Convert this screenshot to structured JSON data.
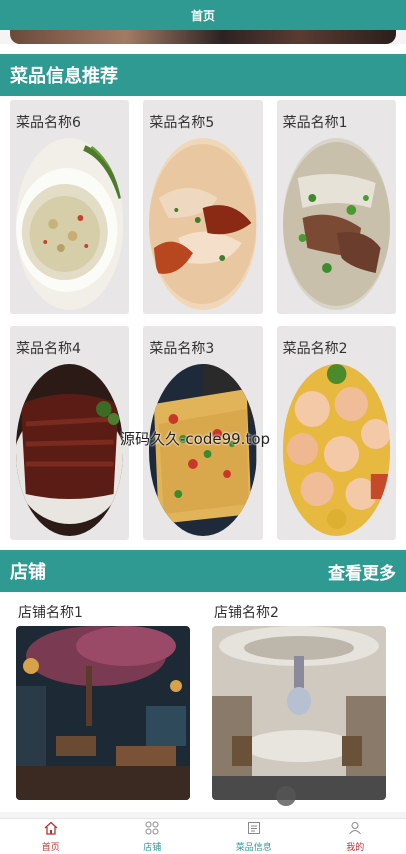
{
  "status_bar": {
    "title": "首页"
  },
  "dishes_section": {
    "title": "菜品信息推荐",
    "items": [
      {
        "name": "菜品名称6",
        "image": "creamy-soup-dish"
      },
      {
        "name": "菜品名称5",
        "image": "wonton-chili-dish"
      },
      {
        "name": "菜品名称1",
        "image": "beef-noodle-soup"
      },
      {
        "name": "菜品名称4",
        "image": "braised-beef-slices"
      },
      {
        "name": "菜品名称3",
        "image": "pizza-slice"
      },
      {
        "name": "菜品名称2",
        "image": "shrimp-dish"
      }
    ]
  },
  "shops_section": {
    "title": "店铺",
    "more_label": "查看更多",
    "items": [
      {
        "name": "店铺名称1",
        "image": "restaurant-interior-trees"
      },
      {
        "name": "店铺名称2",
        "image": "restaurant-interior-chandelier"
      }
    ]
  },
  "watermark": "源码久久-code99.top",
  "bottom_nav": [
    {
      "label": "首页",
      "icon": "home-icon"
    },
    {
      "label": "店铺",
      "icon": "grid-icon"
    },
    {
      "label": "菜品信息",
      "icon": "document-icon"
    },
    {
      "label": "我的",
      "icon": "user-icon"
    }
  ],
  "colors": {
    "primary": "#2f9a92",
    "active": "#c03030"
  }
}
